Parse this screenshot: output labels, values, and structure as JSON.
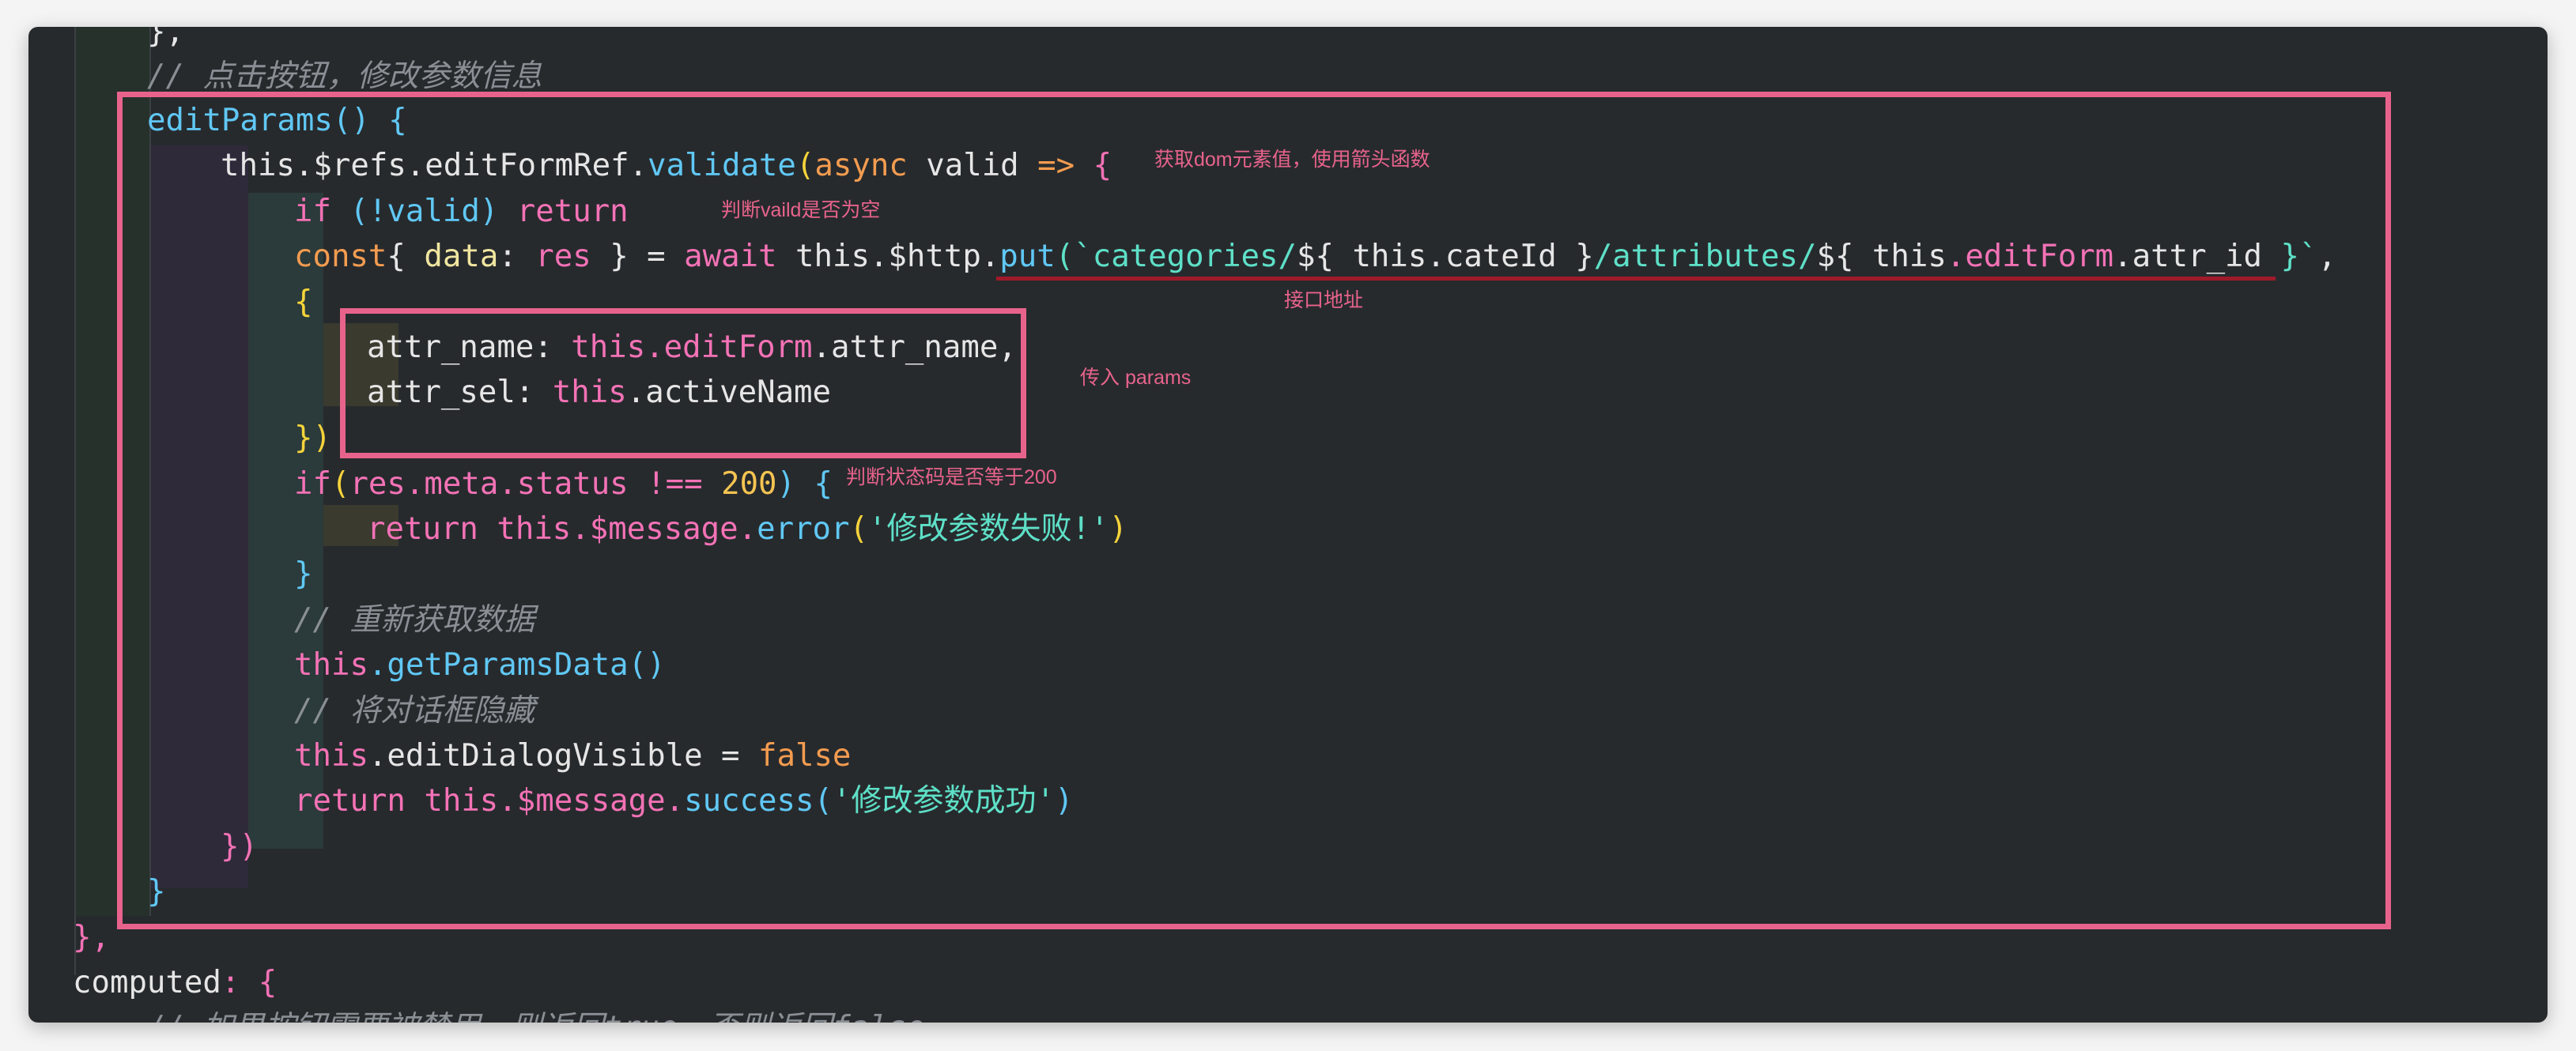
{
  "code_lines": {
    "l0": "},",
    "l1_comment": "// 点击按钮，修改参数信息",
    "l2_fn": "editParams",
    "l2_rest": "() {",
    "l3_this": "this",
    "l3_refs": ".$refs.editFormRef.",
    "l3_validate": "validate",
    "l3_paren": "(",
    "l3_async": "async",
    "l3_valid": " valid ",
    "l3_arrow": "=>",
    "l3_brace": " {",
    "l4_if": "if",
    "l4_mid": " (!valid) ",
    "l4_return": "return",
    "l5_const": "const",
    "l5_a": "{ ",
    "l5_data": "data",
    "l5_b": ": ",
    "l5_res": "res",
    "l5_c": " } = ",
    "l5_await": "await",
    "l5_d": " this.$http.",
    "l5_put": "put",
    "l5_e": "(`",
    "l5_str1": "categories/",
    "l5_tpl1": "${ ",
    "l5_this1": "this",
    "l5_cate": ".cateId ",
    "l5_tpl1e": "}",
    "l5_str2": "/attributes/",
    "l5_tpl2": "${ ",
    "l5_this2": "this",
    "l5_ef": ".editForm",
    "l5_attr": ".attr_id ",
    "l5_tpl2e": "}`",
    "l5_end": ",",
    "l6": "{",
    "l7_key": "attr_name: ",
    "l7_this": "this",
    "l7_ef": ".editForm",
    "l7_rest": ".attr_name,",
    "l8_key": "attr_sel: ",
    "l8_this": "this",
    "l8_rest": ".activeName",
    "l9": "})",
    "l10_if": "if",
    "l10_a": "(",
    "l10_res": "res",
    "l10_meta": ".meta.status ",
    "l10_op": "!==",
    "l10_num": " 200",
    "l10_end": ") {",
    "l11_return": "return",
    "l11_this": " this",
    "l11_msg": ".$message.",
    "l11_err": "error",
    "l11_p": "(",
    "l11_str": "'修改参数失败!'",
    "l11_pe": ")",
    "l12": "}",
    "l13_comment": "// 重新获取数据",
    "l14_this": "this",
    "l14_fn": ".getParamsData",
    "l14_p": "()",
    "l15_comment": "// 将对话框隐藏",
    "l16_this": "this",
    "l16_rest": ".editDialogVisible = ",
    "l16_false": "false",
    "l17_return": "return",
    "l17_this": " this",
    "l17_msg": ".$message.",
    "l17_succ": "success",
    "l17_p": "(",
    "l17_str": "'修改参数成功'",
    "l17_pe": ")",
    "l18": "})",
    "l19": "}",
    "l20": "},",
    "l21_key": "computed",
    "l21_rest": ": {",
    "l22_comment": "// 如果按钮需要被禁用，则返回true，否则返回false"
  },
  "annotations": {
    "dom_value": "获取dom元素值，使用箭头函数",
    "valid_check": "判断vaild是否为空",
    "api_url": "接口地址",
    "params": "传入 params",
    "status_check": "判断状态码是否等于200"
  },
  "colors": {
    "keyword": "#f472b6",
    "function": "#60c8f5",
    "string": "#5ee0c8",
    "comment": "#8a8f95",
    "annotation": "#e8638c"
  }
}
